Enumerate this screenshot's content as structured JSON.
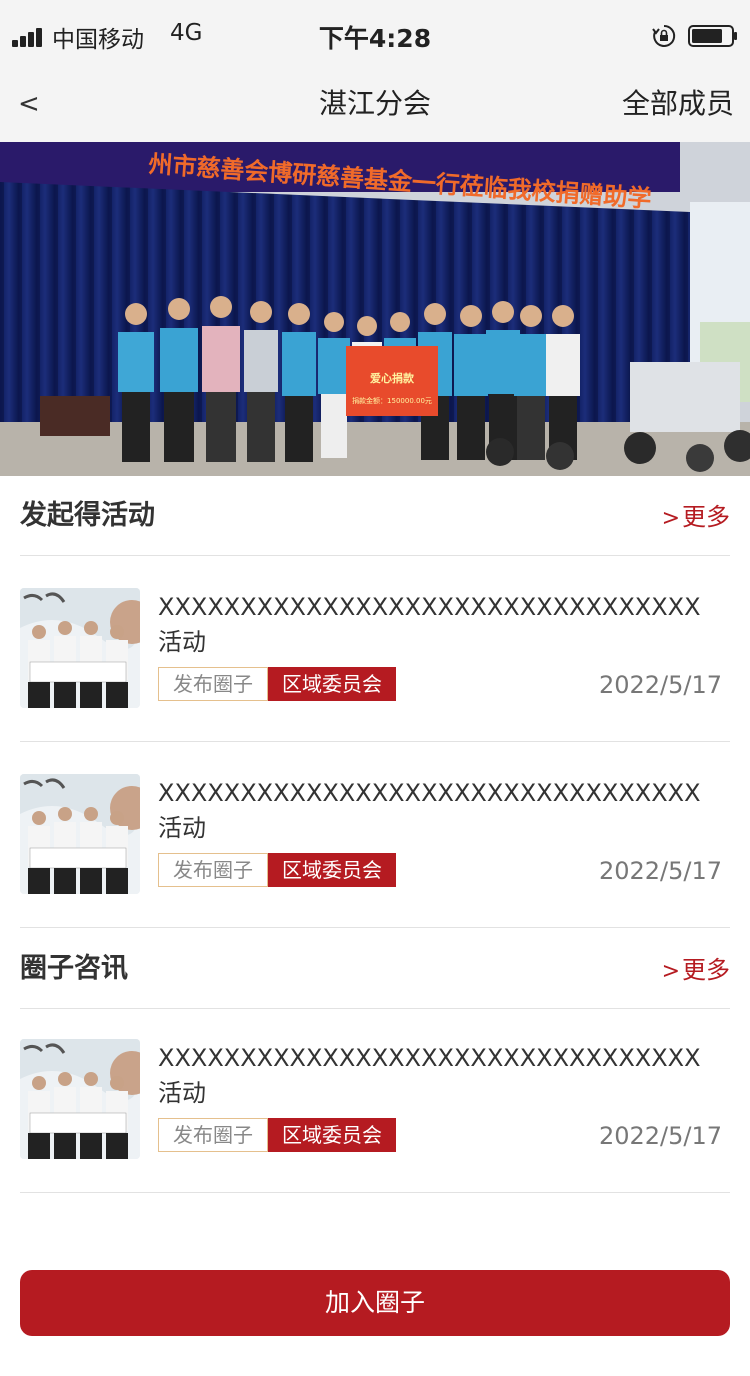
{
  "status": {
    "carrier": "中国移动",
    "network": "4G",
    "time": "下午4:28"
  },
  "nav": {
    "back": "<",
    "title": "湛江分会",
    "right": "全部成员"
  },
  "banner": {
    "headline": "州市慈善会博研慈善基金一行莅临我校捐赠助学",
    "board_title": "爱心捐款",
    "board_amount": "捐款金额：150000.00元"
  },
  "sections": [
    {
      "title": "发起得活动",
      "more": "更多",
      "items": [
        {
          "title": "XXXXXXXXXXXXXXXXXXXXXXXXXXXXXXXXX活动",
          "tag1": "发布圈子",
          "tag2": "区域委员会",
          "date": "2022/5/17"
        },
        {
          "title": "XXXXXXXXXXXXXXXXXXXXXXXXXXXXXXXXX活动",
          "tag1": "发布圈子",
          "tag2": "区域委员会",
          "date": "2022/5/17"
        }
      ]
    },
    {
      "title": "圈子咨讯",
      "more": "更多",
      "items": [
        {
          "title": "XXXXXXXXXXXXXXXXXXXXXXXXXXXXXXXXX活动",
          "tag1": "发布圈子",
          "tag2": "区域委员会",
          "date": "2022/5/17"
        }
      ]
    }
  ],
  "join_button": "加入圈子",
  "colors": {
    "accent": "#b51b21",
    "tag_border": "#e5c08d",
    "nav_bg": "#f4f4f4"
  },
  "icons": [
    "signal-icon",
    "lock-rotation-icon",
    "battery-icon",
    "back-icon"
  ]
}
